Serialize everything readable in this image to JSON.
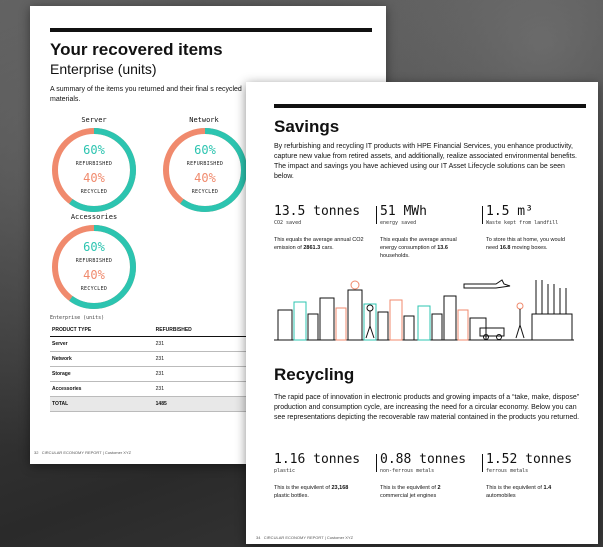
{
  "page1": {
    "title": "Your recovered items",
    "subtitle": "Enterprise (units)",
    "intro": "A summary of the items you returned and their final s recycled materials.",
    "rings": [
      {
        "label": "Server",
        "refurbished_pct": "60%",
        "refurbished_label": "REFURBISHED",
        "recycled_pct": "40%",
        "recycled_label": "RECYCLED"
      },
      {
        "label": "Network",
        "refurbished_pct": "60%",
        "refurbished_label": "REFURBISHED",
        "recycled_pct": "40%",
        "recycled_label": "RECYCLED"
      },
      {
        "label": "Accessories",
        "refurbished_pct": "60%",
        "refurbished_label": "REFURBISHED",
        "recycled_pct": "40%",
        "recycled_label": "RECYCLED"
      }
    ],
    "refurbished_fraction": 0.6,
    "colors": {
      "refurbished": "#2cc4b0",
      "recycled": "#f08a6d"
    },
    "table": {
      "caption": "Enterprise (units)",
      "headers": [
        "PRODUCT TYPE",
        "REFURBISHED"
      ],
      "rows": [
        [
          "Server",
          "231"
        ],
        [
          "Network",
          "231"
        ],
        [
          "Storage",
          "231"
        ],
        [
          "Accessories",
          "231"
        ]
      ],
      "total": [
        "TOTAL",
        "1485"
      ]
    },
    "footer_num": "32",
    "footer_text": "CIRCULAR ECONOMY REPORT | Customer XYZ"
  },
  "page2": {
    "savings_title": "Savings",
    "savings_body": "By refurbishing and recycling IT products with HPE Financial Services, you enhance productivity, capture new value from retired assets, and additionally, realize associated environmental benefits. The impact and savings you have achieved using our IT Asset Lifecycle solutions can be seen below.",
    "savings_stats": [
      {
        "value": "13.5 tonnes",
        "unit": "CO2 saved",
        "desc_a": "This equals the average annual CO2 emission of ",
        "desc_b": "2861.3",
        "desc_c": " cars."
      },
      {
        "value": "51 MWh",
        "unit": "energy saved",
        "desc_a": "This equals the average annual energy consumption of ",
        "desc_b": "13.6",
        "desc_c": " households."
      },
      {
        "value": "1.5 m³",
        "unit": "Waste kept from landfill",
        "desc_a": "To store this at home, you would need ",
        "desc_b": "16.8",
        "desc_c": " moving boxes."
      }
    ],
    "recycling_title": "Recycling",
    "recycling_body": "The rapid pace of innovation in electronic products and growing impacts of a “take, make, dispose” production and consumption cycle, are increasing the need for a circular economy. Below you can see representations depicting the recoverable raw material contained in the products you returned.",
    "recycling_stats": [
      {
        "value": "1.16 tonnes",
        "unit": "plastic",
        "desc_a": "This is the equivilent of ",
        "desc_b": "23,168",
        "desc_c": " plastic bottles."
      },
      {
        "value": "0.88 tonnes",
        "unit": "non-ferrous metals",
        "desc_a": "This is the equivilent of ",
        "desc_b": "2",
        "desc_c": " commercial jet engines"
      },
      {
        "value": "1.52 tonnes",
        "unit": "ferrous metals",
        "desc_a": "This is the equivilent of ",
        "desc_b": "1.4",
        "desc_c": " automobiles"
      }
    ],
    "footer_num": "34",
    "footer_text": "CIRCULAR ECONOMY REPORT | Customer XYZ"
  }
}
